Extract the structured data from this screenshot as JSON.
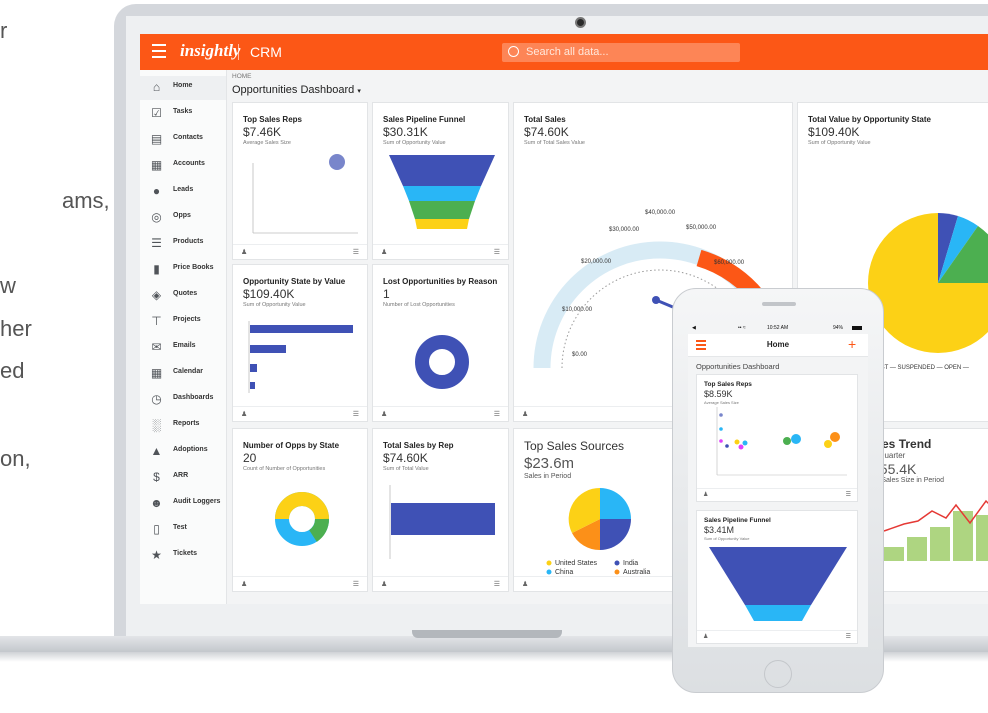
{
  "left_text_fragments": [
    "r",
    "ams,",
    "w",
    "her",
    "ed",
    "on,"
  ],
  "app": {
    "brand": "insightly",
    "product": "CRM",
    "search_placeholder": "Search all data...",
    "brand_color": "#fc5716"
  },
  "sidebar": {
    "items": [
      {
        "label": "Home",
        "icon": "home-icon"
      },
      {
        "label": "Tasks",
        "icon": "tasks-icon"
      },
      {
        "label": "Contacts",
        "icon": "contacts-icon"
      },
      {
        "label": "Accounts",
        "icon": "accounts-icon"
      },
      {
        "label": "Leads",
        "icon": "leads-icon"
      },
      {
        "label": "Opps",
        "icon": "opps-icon"
      },
      {
        "label": "Products",
        "icon": "products-icon"
      },
      {
        "label": "Price Books",
        "icon": "price-books-icon"
      },
      {
        "label": "Quotes",
        "icon": "quotes-icon"
      },
      {
        "label": "Projects",
        "icon": "projects-icon"
      },
      {
        "label": "Emails",
        "icon": "emails-icon"
      },
      {
        "label": "Calendar",
        "icon": "calendar-icon"
      },
      {
        "label": "Dashboards",
        "icon": "dashboards-icon"
      },
      {
        "label": "Reports",
        "icon": "reports-icon"
      },
      {
        "label": "Adoptions",
        "icon": "adoptions-icon"
      },
      {
        "label": "ARR",
        "icon": "dollar-icon"
      },
      {
        "label": "Audit Loggers",
        "icon": "audit-icon"
      },
      {
        "label": "Test",
        "icon": "file-icon"
      },
      {
        "label": "Tickets",
        "icon": "tickets-icon"
      }
    ]
  },
  "breadcrumb": "HOME",
  "dashboard_title": "Opportunities Dashboard",
  "cards": {
    "top_sales_reps": {
      "title": "Top Sales Reps",
      "value": "$7.46K",
      "sub": "Average Sales Size"
    },
    "pipeline": {
      "title": "Sales Pipeline Funnel",
      "value": "$30.31K",
      "sub": "Sum of Opportunity Value"
    },
    "total_sales": {
      "title": "Total Sales",
      "value": "$74.60K",
      "sub": "Sum of Total Sales Value",
      "gauge_labels": [
        "$0.00",
        "$10,000.00",
        "$20,000.00",
        "$30,000.00",
        "$40,000.00",
        "$50,000.00",
        "$60,000.00"
      ]
    },
    "total_value_state": {
      "title": "Total Value by Opportunity State",
      "value": "$109.40K",
      "sub": "Sum of Opportunity Value",
      "legend": "OST — SUSPENDED — OPEN —"
    },
    "opp_state_value": {
      "title": "Opportunity State by Value",
      "value": "$109.40K",
      "sub": "Sum of Opportunity Value"
    },
    "lost_opps": {
      "title": "Lost Opportunities by Reason",
      "value": "1",
      "sub": "Number of Lost Opportunities"
    },
    "num_opps": {
      "title": "Number of Opps by State",
      "value": "20",
      "sub": "Count of Number of Opportunities"
    },
    "sales_by_rep": {
      "title": "Total Sales by Rep",
      "value": "$74.60K",
      "sub": "Sum of Total Value"
    },
    "top_sources": {
      "title": "Top Sales Sources",
      "value": "$23.6m",
      "sub": "Sales in Period",
      "legend": [
        "United States",
        "India",
        "China",
        "Australia"
      ]
    },
    "sales_trend": {
      "title": "ales Trend",
      "sub1": "y Quarter",
      "value": "$55.4K",
      "sub2": "vg Sales Size in Period"
    }
  },
  "phone": {
    "time": "10:52 AM",
    "battery": "94%",
    "header": "Home",
    "section": "Opportunities Dashboard",
    "card1": {
      "title": "Top Sales Reps",
      "value": "$8.59K",
      "sub": "Average Sales Size"
    },
    "card2": {
      "title": "Sales Pipeline Funnel",
      "value": "$3.41M",
      "sub": "Sum of Opportunity Value"
    }
  },
  "colors": {
    "blue": "#3f51b5",
    "green": "#4caf50",
    "yellow": "#fcd116",
    "light_blue": "#29b6f6",
    "orange": "#fc5716"
  }
}
